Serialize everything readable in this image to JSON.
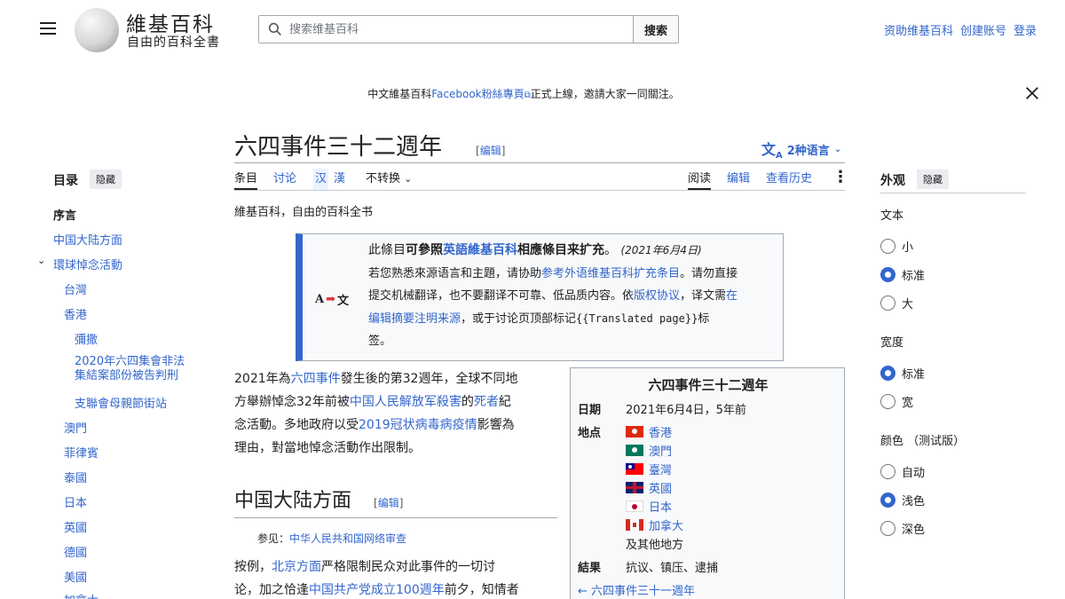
{
  "header": {
    "logo_title": "維基百科",
    "logo_subtitle": "自由的百科全書",
    "search_placeholder": "搜索维基百科",
    "search_button": "搜索",
    "user_links": [
      "资助维基百科",
      "创建账号",
      "登录"
    ]
  },
  "sitenotice": {
    "prefix": "中文維基百科",
    "link": "Facebook粉絲專頁",
    "suffix": "正式上線，邀請大家一同關注。"
  },
  "title": {
    "text": "六四事件三十二週年",
    "edit": "编辑",
    "languages": "2种语言"
  },
  "tabs": {
    "left": [
      "条目",
      "讨论"
    ],
    "variant_a": "汉",
    "variant_b": "漢",
    "convert": "不转换",
    "right": [
      "阅读",
      "编辑",
      "查看历史"
    ]
  },
  "tagline": "維基百科，自由的百科全书",
  "toc": {
    "heading": "目录",
    "hide": "隐藏",
    "items": [
      {
        "label": "序言",
        "level": 0,
        "bold": true
      },
      {
        "label": "中国大陆方面",
        "level": 0
      },
      {
        "label": "環球悼念活動",
        "level": 0,
        "expanded": true
      },
      {
        "label": "台灣",
        "level": 1
      },
      {
        "label": "香港",
        "level": 1
      },
      {
        "label": "彌撒",
        "level": 2
      },
      {
        "label": "2020年六四集會非法集結案部份被告判刑",
        "level": 2,
        "lines": [
          "2020年六四集會非法",
          "集結案部份被告判刑"
        ]
      },
      {
        "label": "支聯會母親節街站",
        "level": 2
      },
      {
        "label": "澳門",
        "level": 1
      },
      {
        "label": "菲律賓",
        "level": 1
      },
      {
        "label": "泰國",
        "level": 1
      },
      {
        "label": "日本",
        "level": 1
      },
      {
        "label": "英國",
        "level": 1
      },
      {
        "label": "德國",
        "level": 1
      },
      {
        "label": "美國",
        "level": 1
      },
      {
        "label": "加拿大",
        "level": 1
      }
    ]
  },
  "ambox": {
    "icon_left": "A",
    "icon_right": "文",
    "line1_pre": "此條目",
    "line1_bold": "可參照",
    "line1_link": "英語維基百科",
    "line1_bold2": "相應條目来扩充",
    "line1_date": "(2021年6月4日)",
    "line2_pre": "若您熟悉來源语言和主題，请协助",
    "line2_link": "参考外语维基百科扩充条目",
    "line2_post": "。请勿直接",
    "line3_pre": "提交机械翻译，也不要翻译不可靠、低品质内容。依",
    "line3_link1": "版权协议",
    "line3_mid": "，译文需",
    "line3_link2": "在",
    "line4_link": "编辑摘要注明来源",
    "line4_mid": "，或于讨论页顶部标记",
    "line4_code": "{{Translated page}}",
    "line4_post": "标",
    "line5": "签。"
  },
  "intro": {
    "l1_pre": "2021年為",
    "l1_link": "六四事件",
    "l1_post": "發生後的第32週年，全球不同地",
    "l2_pre": "方舉辦悼念32年前被",
    "l2_link1": "中国人民解放军殺害",
    "l2_mid": "的",
    "l2_link2": "死者",
    "l2_post": "紀",
    "l3_pre": "念活動。多地政府以受",
    "l3_link": "2019冠状病毒病疫情",
    "l3_post": "影響為",
    "l4": "理由，對當地悼念活動作出限制。"
  },
  "section1": {
    "heading": "中国大陆方面",
    "edit": "编辑",
    "seealso_label": "参见：",
    "seealso_link": "中华人民共和国网络审查",
    "p1_pre": "按例，",
    "p1_link": "北京方面",
    "p1_post": "严格限制民众对此事件的一切讨",
    "p2_pre": "论，加之恰逢",
    "p2_link": "中国共产党成立100週年",
    "p2_post": "前夕，知情者"
  },
  "infobox": {
    "title": "六四事件三十二週年",
    "date_label": "日期",
    "date_value": "2021年6月4日，5年前",
    "place_label": "地点",
    "places": [
      "香港",
      "澳門",
      "臺灣",
      "英國",
      "日本",
      "加拿大"
    ],
    "other_places": "及其他地方",
    "result_label": "結果",
    "result_value": "抗议、镇压、逮捕",
    "prev": "← 六四事件三十一週年"
  },
  "appearance": {
    "heading": "外观",
    "hide": "隐藏",
    "text_label": "文本",
    "text_options": [
      "小",
      "标准",
      "大"
    ],
    "text_selected": 1,
    "width_label": "宽度",
    "width_options": [
      "标准",
      "宽"
    ],
    "width_selected": 0,
    "color_label": "颜色 （测试版）",
    "color_options": [
      "自动",
      "浅色",
      "深色"
    ],
    "color_selected": 1
  },
  "colors": {
    "link": "#3366cc",
    "accent": "#36c",
    "border": "#a2a9b1"
  }
}
